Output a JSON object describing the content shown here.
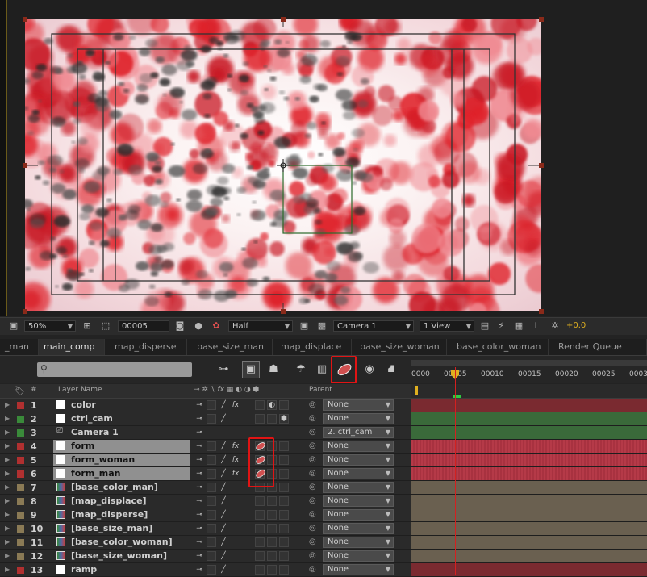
{
  "viewer": {
    "zoom": "50%",
    "frame": "00005",
    "resolution": "Half",
    "camera": "Camera 1",
    "views": "1 View",
    "exposure": "+0.0"
  },
  "tabs": [
    {
      "label": "_man"
    },
    {
      "label": "main_comp",
      "active": true
    },
    {
      "label": "map_disperse"
    },
    {
      "label": "base_size_man"
    },
    {
      "label": "map_displace"
    },
    {
      "label": "base_size_woman"
    },
    {
      "label": "base_color_woman"
    },
    {
      "label": "Render Queue"
    }
  ],
  "timeline": {
    "ruler": [
      "0000",
      "00005",
      "00010",
      "00015",
      "00020",
      "00025",
      "0003"
    ],
    "header": {
      "num": "#",
      "layer_name": "Layer Name",
      "parent": "Parent"
    }
  },
  "layers": [
    {
      "num": "1",
      "name": "color",
      "label_color": "#b03030",
      "icon": "solid-white",
      "parent": "None",
      "track": "#7a2a30"
    },
    {
      "num": "2",
      "name": "ctrl_cam",
      "label_color": "#3a8a3a",
      "icon": "solid-white",
      "parent": "None",
      "track": "#3a6a3a"
    },
    {
      "num": "3",
      "name": "Camera 1",
      "label_color": "#3a8a3a",
      "icon": "camera",
      "parent": "2. ctrl_cam",
      "track": "#3a6a3a"
    },
    {
      "num": "4",
      "name": "form",
      "label_color": "#b03030",
      "icon": "solid-white",
      "parent": "None",
      "track": "#b03040",
      "selected": true
    },
    {
      "num": "5",
      "name": "form_woman",
      "label_color": "#b03030",
      "icon": "solid-white",
      "parent": "None",
      "track": "#b03040",
      "selected": true
    },
    {
      "num": "6",
      "name": "form_man",
      "label_color": "#b03030",
      "icon": "solid-white",
      "parent": "None",
      "track": "#b03040",
      "selected": true
    },
    {
      "num": "7",
      "name": "[base_color_man]",
      "label_color": "#8a7a55",
      "icon": "comp",
      "parent": "None",
      "track": "#6a6050"
    },
    {
      "num": "8",
      "name": "[map_displace]",
      "label_color": "#8a7a55",
      "icon": "comp",
      "parent": "None",
      "track": "#6a6050"
    },
    {
      "num": "9",
      "name": "[map_disperse]",
      "label_color": "#8a7a55",
      "icon": "comp",
      "parent": "None",
      "track": "#6a6050"
    },
    {
      "num": "10",
      "name": "[base_size_man]",
      "label_color": "#8a7a55",
      "icon": "comp",
      "parent": "None",
      "track": "#6a6050"
    },
    {
      "num": "11",
      "name": "[base_color_woman]",
      "label_color": "#8a7a55",
      "icon": "comp",
      "parent": "None",
      "track": "#6a6050"
    },
    {
      "num": "12",
      "name": "[base_size_woman]",
      "label_color": "#8a7a55",
      "icon": "comp",
      "parent": "None",
      "track": "#6a6050"
    },
    {
      "num": "13",
      "name": "ramp",
      "label_color": "#b03030",
      "icon": "solid-white",
      "parent": "None",
      "track": "#7a2a30"
    }
  ]
}
